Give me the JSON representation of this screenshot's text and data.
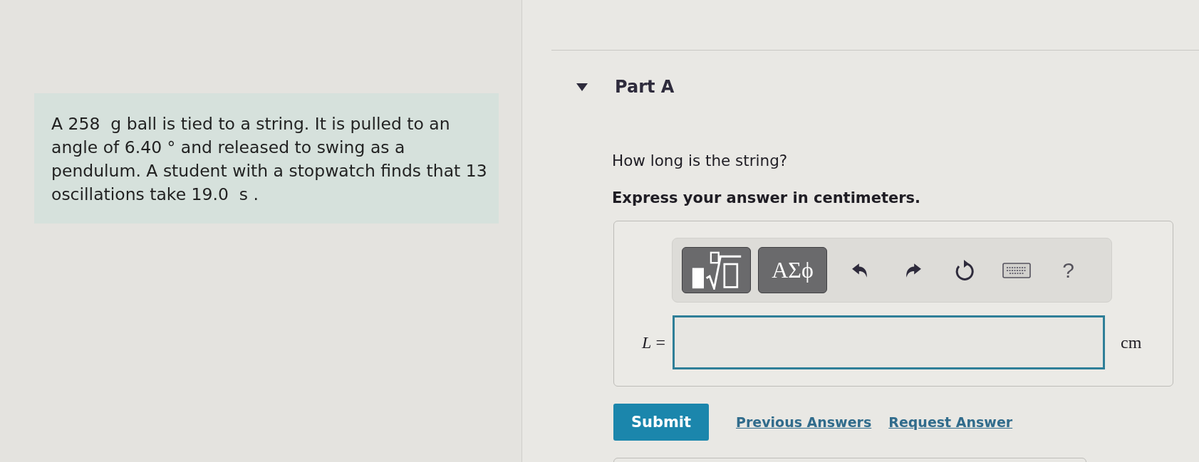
{
  "problem": {
    "text": "A 258  g ball is tied to a string. It is pulled to an angle of 6.40 ° and released to swing as a pendulum. A student with a stopwatch finds that 13 oscillations take 19.0  s ."
  },
  "part": {
    "title": "Part A",
    "expanded": true,
    "question": "How long is the string?",
    "instruction": "Express your answer in centimeters."
  },
  "answer": {
    "toolbar": [
      {
        "kind": "templates"
      },
      {
        "kind": "symbols",
        "label": "ΑΣϕ"
      },
      {
        "kind": "undo"
      },
      {
        "kind": "redo"
      },
      {
        "kind": "reset"
      },
      {
        "kind": "keyboard"
      },
      {
        "kind": "help",
        "label": "?"
      }
    ],
    "variable": "*L* =",
    "unit": "cm"
  },
  "actions": {
    "submit": "Submit",
    "links": [
      "Previous Answers",
      "Request Answer"
    ]
  }
}
